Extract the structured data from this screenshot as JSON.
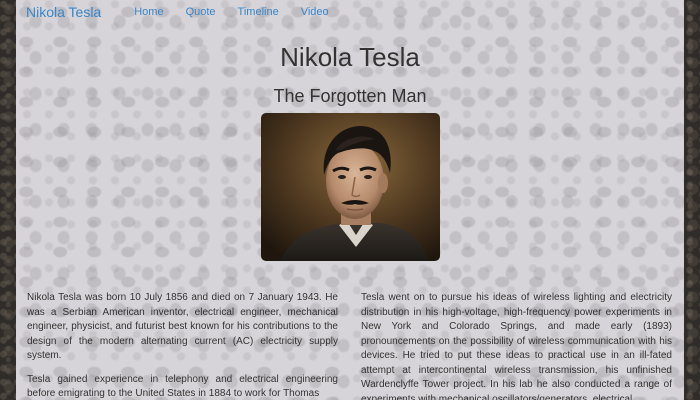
{
  "navbar": {
    "brand": "Nikola Tesla",
    "links": [
      "Home",
      "Quote",
      "Timeline",
      "Video"
    ]
  },
  "header": {
    "title": "Nikola Tesla",
    "subtitle": "The Forgotten Man"
  },
  "portrait": {
    "icon": "portrait-image"
  },
  "bio": {
    "left_paragraphs": [
      "Nikola Tesla was born 10 July 1856 and died on 7 January 1943. He was a Serbian American inventor, electrical engineer, mechanical engineer, physicist, and futurist best known for his contributions to the design of the modern alternating current (AC) electricity supply system.",
      "Tesla gained experience in telephony and electrical engineering before emigrating to the United States in 1884 to work for Thomas"
    ],
    "right_paragraphs": [
      "Tesla went on to pursue his ideas of wireless lighting and electricity distribution in his high-voltage, high-frequency power experiments in New York and Colorado Springs, and made early (1893) pronouncements on the possibility of wireless communication with his devices. He tried to put these ideas to practical use in an ill-fated attempt at intercontinental wireless transmission, his unfinished Wardenclyffe Tower project. In his lab he also conducted a range of experiments with mechanical oscillators/generators, electrical"
    ]
  },
  "colors": {
    "link": "#3a86c8",
    "text": "#333333",
    "panel": "#d6d4d8"
  }
}
